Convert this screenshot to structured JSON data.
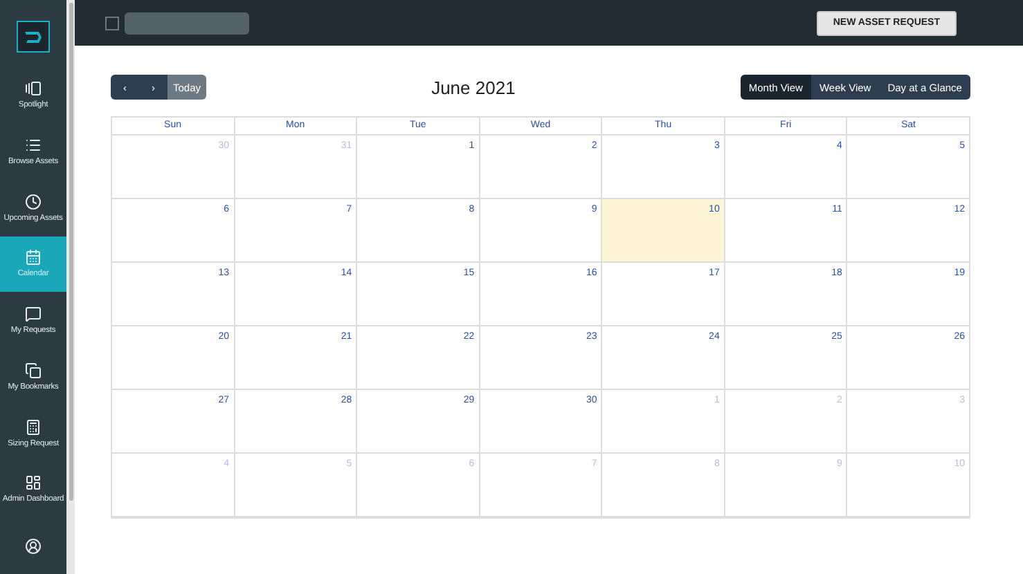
{
  "sidebar": {
    "items": [
      {
        "label": "Spotlight",
        "selected": false
      },
      {
        "label": "Browse Assets",
        "selected": false
      },
      {
        "label": "Upcoming Assets",
        "selected": false
      },
      {
        "label": "Calendar",
        "selected": true
      },
      {
        "label": "My Requests",
        "selected": false
      },
      {
        "label": "My Bookmarks",
        "selected": false
      },
      {
        "label": "Sizing Request",
        "selected": false
      },
      {
        "label": "Admin Dashboard",
        "selected": false
      },
      {
        "selected": false
      }
    ]
  },
  "top_bar": {
    "checked": false,
    "button": "NEW ASSET REQUEST"
  },
  "toolbar": {
    "prev": "‹",
    "next": "›",
    "today": "Today",
    "title": "June 2021",
    "views": [
      {
        "label": "Month View",
        "selected": true
      },
      {
        "label": "Week View",
        "selected": false
      },
      {
        "label": "Day at a Glance",
        "selected": false
      }
    ]
  },
  "calendar": {
    "weekdays": [
      "Sun",
      "Mon",
      "Tue",
      "Wed",
      "Thu",
      "Fri",
      "Sat"
    ],
    "weeks": [
      [
        {
          "label": "30",
          "outside": true,
          "today": false
        },
        {
          "label": "31",
          "outside": true,
          "today": false
        },
        {
          "label": "1",
          "outside": false,
          "today": false
        },
        {
          "label": "2",
          "outside": false,
          "today": false
        },
        {
          "label": "3",
          "outside": false,
          "today": false
        },
        {
          "label": "4",
          "outside": false,
          "today": false
        },
        {
          "label": "5",
          "outside": false,
          "today": false
        }
      ],
      [
        {
          "label": "6",
          "outside": false,
          "today": false
        },
        {
          "label": "7",
          "outside": false,
          "today": false
        },
        {
          "label": "8",
          "outside": false,
          "today": false
        },
        {
          "label": "9",
          "outside": false,
          "today": false
        },
        {
          "label": "10",
          "outside": false,
          "today": true
        },
        {
          "label": "11",
          "outside": false,
          "today": false
        },
        {
          "label": "12",
          "outside": false,
          "today": false
        }
      ],
      [
        {
          "label": "13",
          "outside": false,
          "today": false
        },
        {
          "label": "14",
          "outside": false,
          "today": false
        },
        {
          "label": "15",
          "outside": false,
          "today": false
        },
        {
          "label": "16",
          "outside": false,
          "today": false
        },
        {
          "label": "17",
          "outside": false,
          "today": false
        },
        {
          "label": "18",
          "outside": false,
          "today": false
        },
        {
          "label": "19",
          "outside": false,
          "today": false
        }
      ],
      [
        {
          "label": "20",
          "outside": false,
          "today": false
        },
        {
          "label": "21",
          "outside": false,
          "today": false
        },
        {
          "label": "22",
          "outside": false,
          "today": false
        },
        {
          "label": "23",
          "outside": false,
          "today": false
        },
        {
          "label": "24",
          "outside": false,
          "today": false
        },
        {
          "label": "25",
          "outside": false,
          "today": false
        },
        {
          "label": "26",
          "outside": false,
          "today": false
        }
      ],
      [
        {
          "label": "27",
          "outside": false,
          "today": false
        },
        {
          "label": "28",
          "outside": false,
          "today": false
        },
        {
          "label": "29",
          "outside": false,
          "today": false
        },
        {
          "label": "30",
          "outside": false,
          "today": false
        },
        {
          "label": "1",
          "outside": true,
          "today": false
        },
        {
          "label": "2",
          "outside": true,
          "today": false
        },
        {
          "label": "3",
          "outside": true,
          "today": false
        }
      ],
      [
        {
          "label": "4",
          "outside": true,
          "today": false
        },
        {
          "label": "5",
          "outside": true,
          "today": false
        },
        {
          "label": "6",
          "outside": true,
          "today": false
        },
        {
          "label": "7",
          "outside": true,
          "today": false
        },
        {
          "label": "8",
          "outside": true,
          "today": false
        },
        {
          "label": "9",
          "outside": true,
          "today": false
        },
        {
          "label": "10",
          "outside": true,
          "today": false
        }
      ]
    ]
  }
}
